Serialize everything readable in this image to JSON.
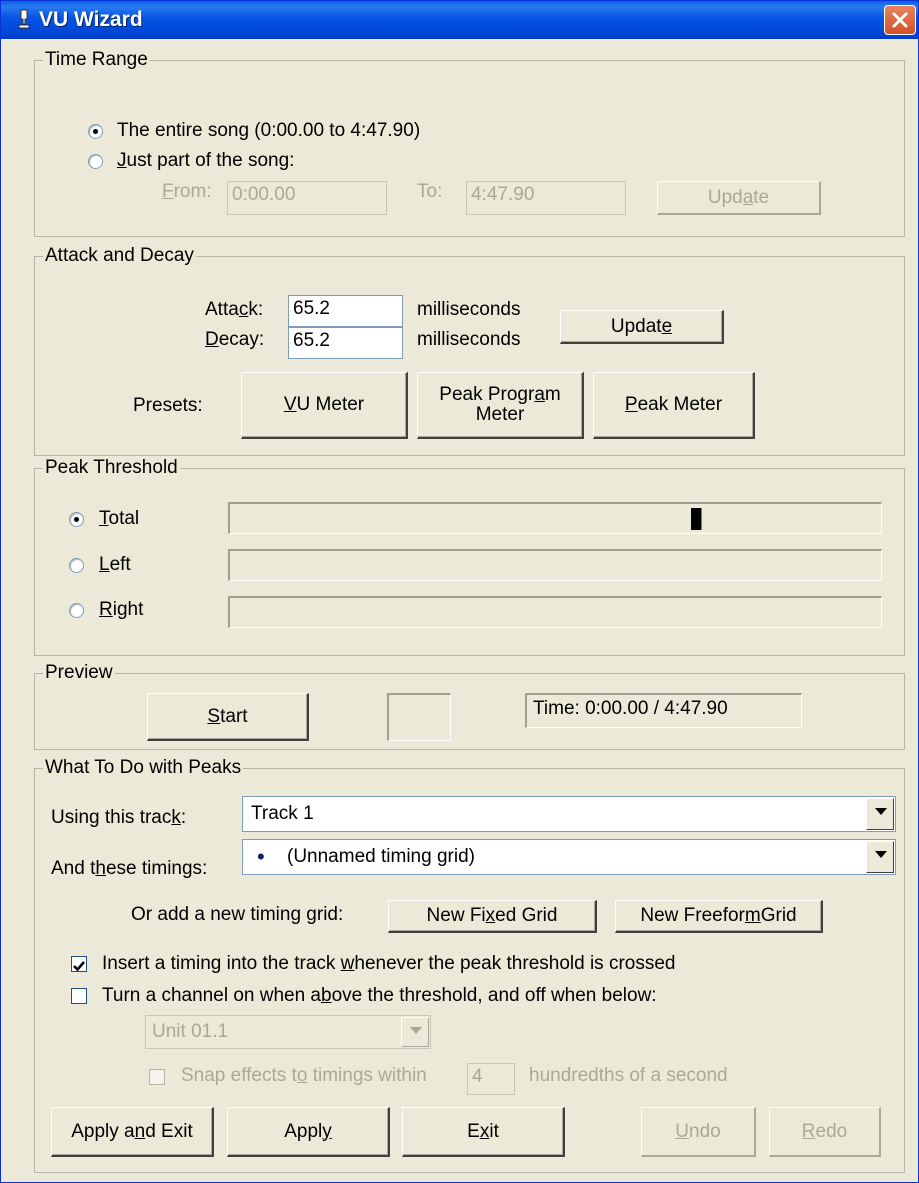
{
  "window": {
    "title": "VU Wizard"
  },
  "time_range": {
    "legend": "Time Range",
    "option_entire": "The entire song (0:00.00 to 4:47.90)",
    "option_entire_selected": true,
    "option_part_pre": "",
    "option_part_ul": "J",
    "option_part_post": "ust part of the song:",
    "from_label_ul": "F",
    "from_label_post": "rom:",
    "from_value": "0:00.00",
    "to_label": "To:",
    "to_value": "4:47.90",
    "update_pre": "Upd",
    "update_ul": "a",
    "update_post": "te"
  },
  "attack_decay": {
    "legend": "Attack and Decay",
    "attack_pre": "Atta",
    "attack_ul": "c",
    "attack_post": "k:",
    "attack_value": "65.2",
    "attack_unit": "milliseconds",
    "decay_ul": "D",
    "decay_post": "ecay:",
    "decay_value": "65.2",
    "decay_unit": "milliseconds",
    "update_pre": "Updat",
    "update_ul": "e",
    "presets_label": "Presets:",
    "preset_vu_ul": "V",
    "preset_vu_post": "U Meter",
    "preset_ppm_line1_pre": "Peak Progr",
    "preset_ppm_line1_ul": "a",
    "preset_ppm_line1_post": "m",
    "preset_ppm_line2": "Meter",
    "preset_peak_ul": "P",
    "preset_peak_post": "eak Meter"
  },
  "peak_threshold": {
    "legend": "Peak Threshold",
    "total_ul": "T",
    "total_post": "otal",
    "left_ul": "L",
    "left_post": "eft",
    "right_pre": "",
    "right_ul": "R",
    "right_post": "ight",
    "selected": "Total",
    "total_level": 0.72
  },
  "preview": {
    "legend": "Preview",
    "start_ul": "S",
    "start_post": "tart",
    "time_text": "Time: 0:00.00 / 4:47.90"
  },
  "peaks": {
    "legend": "What To Do with Peaks",
    "track_label_pre": "Using this trac",
    "track_label_ul": "k",
    "track_label_post": ":",
    "track_value": "Track 1",
    "timings_label_pre": "And t",
    "timings_label_ul": "h",
    "timings_label_post": "ese timings:",
    "timings_bullet": "•",
    "timings_value": "(Unnamed timing grid)",
    "add_grid_label": "Or add a new timing grid:",
    "new_fixed_pre": "New Fi",
    "new_fixed_ul": "x",
    "new_fixed_post": "ed Grid",
    "new_freeform_pre": "New Freefor",
    "new_freeform_ul": "m",
    "new_freeform_post": " Grid",
    "insert_pre": "Insert a timing into the track ",
    "insert_ul": "w",
    "insert_post": "henever the peak threshold is crossed",
    "insert_checked": true,
    "turn_pre": "Turn a channel on when a",
    "turn_ul": "b",
    "turn_post": "ove the threshold, and off when below:",
    "turn_checked": false,
    "unit_value": "Unit 01.1",
    "snap_pre": "Snap effects t",
    "snap_ul": "o",
    "snap_post": " timings within",
    "snap_value": "4",
    "snap_unit": "hundredths of a second"
  },
  "footer": {
    "apply_exit_pre": "Apply a",
    "apply_exit_ul": "n",
    "apply_exit_post": "d Exit",
    "apply_pre": "Appl",
    "apply_ul": "y",
    "exit_pre": "E",
    "exit_ul": "x",
    "exit_post": "it",
    "undo_ul": "U",
    "undo_post": "ndo",
    "redo_ul": "R",
    "redo_post": "edo"
  }
}
